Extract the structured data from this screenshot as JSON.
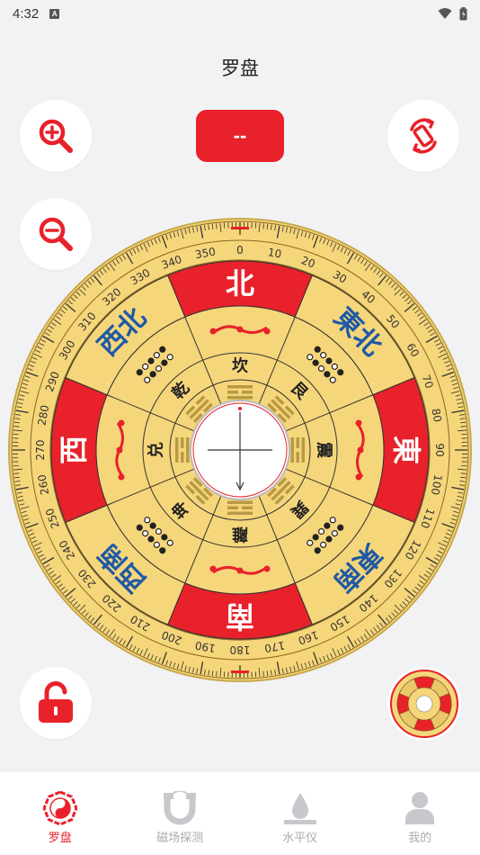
{
  "status": {
    "time": "4:32",
    "app_badge": "A"
  },
  "header": {
    "title": "罗盘"
  },
  "reading": {
    "value": "--"
  },
  "compass": {
    "heading_degrees": 0,
    "cardinals": {
      "north": "北",
      "east": "東",
      "south": "南",
      "west": "西"
    },
    "intercardinals": {
      "northeast": "東北",
      "southeast": "東南",
      "southwest": "西南",
      "northwest": "西北"
    },
    "trigrams": [
      "坎",
      "艮",
      "震",
      "巽",
      "離",
      "坤",
      "兑",
      "乾"
    ],
    "degree_labels": [
      "0",
      "10",
      "20",
      "30",
      "40",
      "50",
      "60",
      "70",
      "80",
      "90",
      "100",
      "110",
      "120",
      "130",
      "140",
      "150",
      "160",
      "170",
      "180",
      "190",
      "200",
      "210",
      "220",
      "230",
      "240",
      "250",
      "260",
      "270",
      "280",
      "290",
      "300",
      "310",
      "320",
      "330",
      "340",
      "350"
    ],
    "colors": {
      "red": "#e8212a",
      "gold": "#f6d67a",
      "blue": "#1f5aa6"
    }
  },
  "nav": {
    "items": [
      {
        "label": "罗盘",
        "icon": "bagua-icon",
        "active": true
      },
      {
        "label": "磁场探测",
        "icon": "magnet-icon",
        "active": false
      },
      {
        "label": "水平仪",
        "icon": "level-drop-icon",
        "active": false
      },
      {
        "label": "我的",
        "icon": "user-icon",
        "active": false
      }
    ]
  }
}
